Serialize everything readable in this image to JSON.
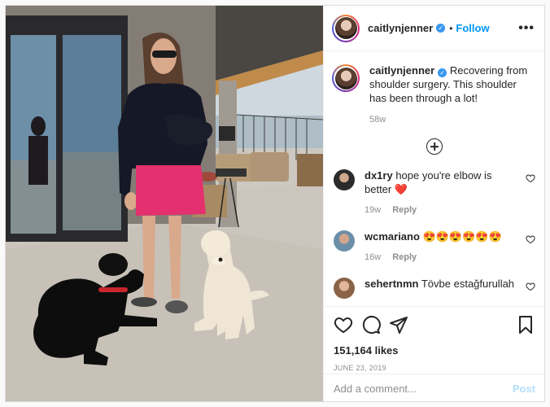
{
  "header": {
    "username": "caitlynjenner",
    "follow_label": "Follow",
    "more_label": "•••"
  },
  "caption": {
    "username": "caitlynjenner",
    "text": "Recovering from shoulder surgery. This shoulder has been through a lot!",
    "time": "58w"
  },
  "comments": [
    {
      "username": "dx1ry",
      "text": "hope you're elbow is better ❤️",
      "time": "19w",
      "reply_label": "Reply"
    },
    {
      "username": "wcmariano",
      "text": "😍😍😍😍😍😍",
      "time": "16w",
      "reply_label": "Reply"
    },
    {
      "username": "sehertnmn",
      "text": "Tövbe estağfurullah",
      "time": "",
      "reply_label": ""
    }
  ],
  "actions": {
    "likes": "151,164 likes",
    "date": "JUNE 23, 2019"
  },
  "add_comment": {
    "placeholder": "Add a comment...",
    "post_label": "Post"
  },
  "icons": [
    "verified-badge-icon",
    "more-options-icon",
    "load-more-comments-icon",
    "heart-icon",
    "comment-icon",
    "share-icon",
    "save-icon"
  ],
  "colors": {
    "accent": "#0095f6",
    "verified": "#3897f0",
    "post_disabled": "#b2dffc",
    "muted": "#8e8e8e"
  }
}
